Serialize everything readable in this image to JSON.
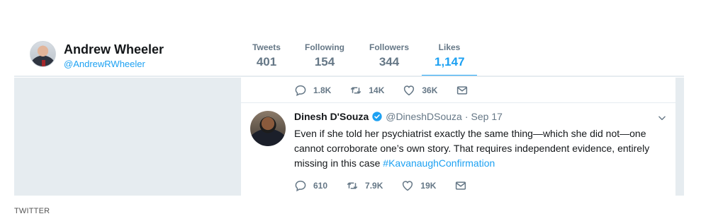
{
  "profile": {
    "display_name": "Andrew Wheeler",
    "handle": "@AndrewRWheeler",
    "stats": [
      {
        "label": "Tweets",
        "value": "401"
      },
      {
        "label": "Following",
        "value": "154"
      },
      {
        "label": "Followers",
        "value": "344"
      },
      {
        "label": "Likes",
        "value": "1,147",
        "active": true
      }
    ]
  },
  "prev_tweet": {
    "replies": "1.8K",
    "retweets": "14K",
    "likes": "36K"
  },
  "tweet": {
    "author": "Dinesh D'Souza",
    "verified": true,
    "handle": "@DineshDSouza",
    "separator": "·",
    "date": "Sep 17",
    "text_main": "Even if she told her psychiatrist exactly the same thing—which she did not—one cannot corroborate one’s own story. That requires independent evidence, entirely missing in this case ",
    "hashtag": "#KavanaughConfirmation",
    "replies": "610",
    "retweets": "7.9K",
    "likes": "19K"
  },
  "credit": "TWITTER",
  "colors": {
    "accent": "#1da1f2",
    "muted": "#657786",
    "panel_bg": "#e6ecf0"
  },
  "icons": [
    "reply-icon",
    "retweet-icon",
    "like-icon",
    "message-icon",
    "verified-badge-icon",
    "chevron-down-icon"
  ]
}
